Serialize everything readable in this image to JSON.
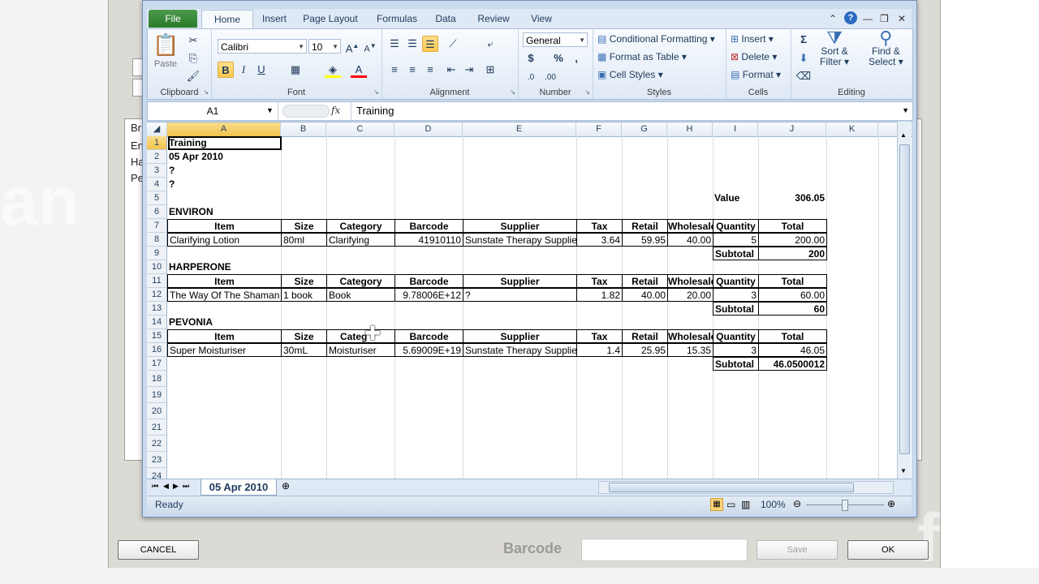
{
  "background": {
    "left_fragments": [
      "Br",
      "En",
      "Ha",
      "Pe"
    ],
    "watermark_left": "an",
    "watermark_right": "ftw",
    "cancel_label": "CANCEL",
    "barcode_label": "Barcode",
    "save_label": "Save",
    "ok_label": "OK"
  },
  "excel": {
    "ribbon_tabs": [
      "File",
      "Home",
      "Insert",
      "Page Layout",
      "Formulas",
      "Data",
      "Review",
      "View"
    ],
    "clipboard": {
      "paste": "Paste",
      "label": "Clipboard"
    },
    "font": {
      "name": "Calibri",
      "size": "10",
      "label": "Font",
      "bold": "B",
      "italic": "I",
      "underline": "U"
    },
    "alignment": {
      "label": "Alignment"
    },
    "number": {
      "format": "General",
      "label": "Number",
      "currency": "$",
      "percent": "%",
      "comma": ","
    },
    "styles": {
      "conditional": "Conditional Formatting",
      "table": "Format as Table",
      "cell_styles": "Cell Styles",
      "label": "Styles"
    },
    "cells": {
      "insert": "Insert",
      "delete": "Delete",
      "format": "Format",
      "label": "Cells"
    },
    "editing": {
      "sum": "Σ",
      "sort": "Sort &",
      "filter": "Filter",
      "find": "Find &",
      "select": "Select",
      "label": "Editing"
    },
    "namebox": "A1",
    "fx": "fx",
    "formula": "Training",
    "columns": [
      "A",
      "B",
      "C",
      "D",
      "E",
      "F",
      "G",
      "H",
      "I",
      "J",
      "K"
    ],
    "rows": [
      "1",
      "2",
      "3",
      "4",
      "5",
      "6",
      "7",
      "8",
      "9",
      "10",
      "11",
      "12",
      "13",
      "14",
      "15",
      "16",
      "17",
      "18",
      "19",
      "20",
      "21",
      "22",
      "23",
      "24"
    ],
    "sheet_tab": "05 Apr 2010",
    "status": "Ready",
    "zoom": "100%"
  },
  "cells": {
    "A1": "Training",
    "A2": "05 Apr 2010",
    "A3": "?",
    "A4": "?",
    "I5": "Value",
    "J5": "306.05",
    "A6": "ENVIRON",
    "hdr": [
      "Item",
      "Size",
      "Category",
      "Barcode",
      "Supplier",
      "Tax",
      "Retail",
      "Wholesale",
      "Quantity",
      "Total"
    ],
    "row8": [
      "Clarifying Lotion",
      "80ml",
      "Clarifying",
      "41910110",
      "Sunstate Therapy Supplie",
      "3.64",
      "59.95",
      "40.00",
      "5",
      "200.00"
    ],
    "I9": "Subtotal",
    "J9": "200",
    "A10": "HARPERONE",
    "row12": [
      "The Way Of The Shaman",
      "1 book",
      "Book",
      "9.78006E+12",
      "?",
      "1.82",
      "40.00",
      "20.00",
      "3",
      "60.00"
    ],
    "I13": "Subtotal",
    "J13": "60",
    "A14": "PEVONIA",
    "hdr15": [
      "Item",
      "Size",
      "Categ",
      "Barcode",
      "Supplier",
      "Tax",
      "Retail",
      "Wholesale",
      "Quantity",
      "Total"
    ],
    "row16": [
      "Super Moisturiser",
      "30mL",
      "Moisturiser",
      "5.69009E+19",
      "Sunstate Therapy Supplie",
      "1.4",
      "25.95",
      "15.35",
      "3",
      "46.05"
    ],
    "I17": "Subtotal",
    "J17": "46.0500012"
  }
}
